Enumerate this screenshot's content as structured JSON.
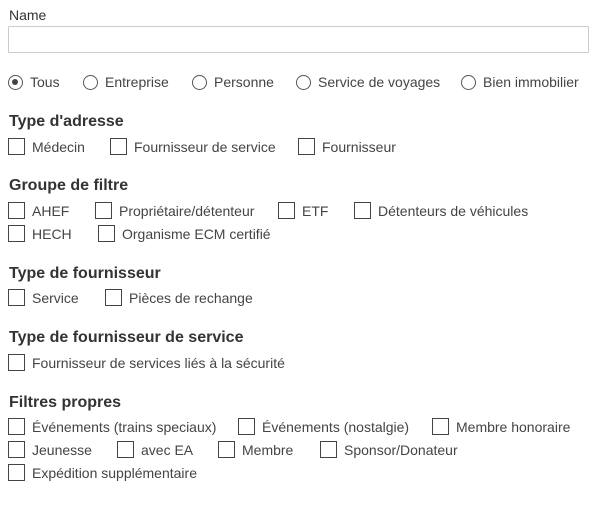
{
  "name_field": {
    "label": "Name",
    "value": "",
    "placeholder": ""
  },
  "scope": {
    "selected": "Tous",
    "options": [
      "Tous",
      "Entreprise",
      "Personne",
      "Service de voyages",
      "Bien immobilier"
    ]
  },
  "type_adresse": {
    "title": "Type d'adresse",
    "items": [
      "Médecin",
      "Fournisseur de service",
      "Fournisseur"
    ]
  },
  "groupe_filtre": {
    "title": "Groupe de filtre",
    "items": [
      "AHEF",
      "Propriétaire/détenteur",
      "ETF",
      "Détenteurs de véhicules",
      "HECH",
      "Organisme ECM certifié"
    ]
  },
  "type_fournisseur": {
    "title": "Type de fournisseur",
    "items": [
      "Service",
      "Pièces de rechange"
    ]
  },
  "type_fournisseur_service": {
    "title": "Type de fournisseur de service",
    "items": [
      "Fournisseur de services liés à la sécurité"
    ]
  },
  "filtres_propres": {
    "title": "Filtres propres",
    "items": [
      "Événements (trains speciaux)",
      "Événements (nostalgie)",
      "Membre honoraire",
      "Jeunesse",
      "avec EA",
      "Membre",
      "Sponsor/Donateur",
      "Expédition supplémentaire"
    ]
  }
}
